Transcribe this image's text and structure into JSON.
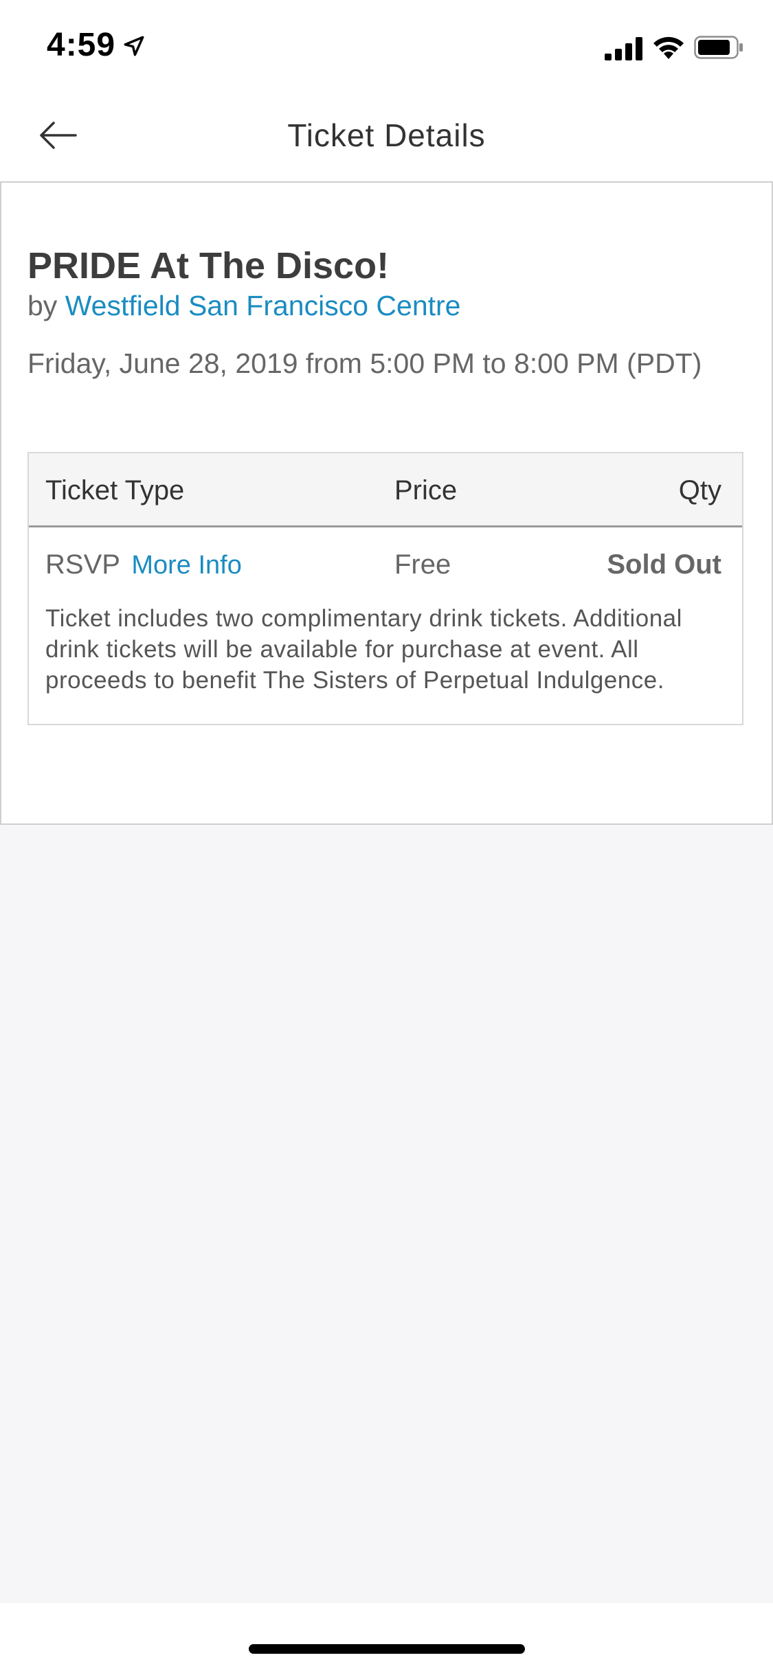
{
  "status_bar": {
    "time": "4:59"
  },
  "nav": {
    "title": "Ticket Details"
  },
  "event": {
    "title": "PRIDE At The Disco!",
    "by_prefix": "by ",
    "organizer": "Westfield San Francisco Centre",
    "date_line": "Friday, June 28, 2019 from 5:00 PM to 8:00 PM (PDT)"
  },
  "ticket_table": {
    "headers": {
      "type": "Ticket Type",
      "price": "Price",
      "qty": "Qty"
    },
    "rows": [
      {
        "type": "RSVP",
        "more_info": "More Info",
        "price": "Free",
        "qty": "Sold Out",
        "description": "Ticket includes two complimentary drink tickets. Additional drink tickets will be available for purchase at event. All proceeds to benefit The Sisters of Perpetual Indulgence."
      }
    ]
  },
  "colors": {
    "link": "#1a8cc1",
    "text_primary": "#3d3d3d",
    "text_secondary": "#666666",
    "background": "#f6f6f8"
  }
}
